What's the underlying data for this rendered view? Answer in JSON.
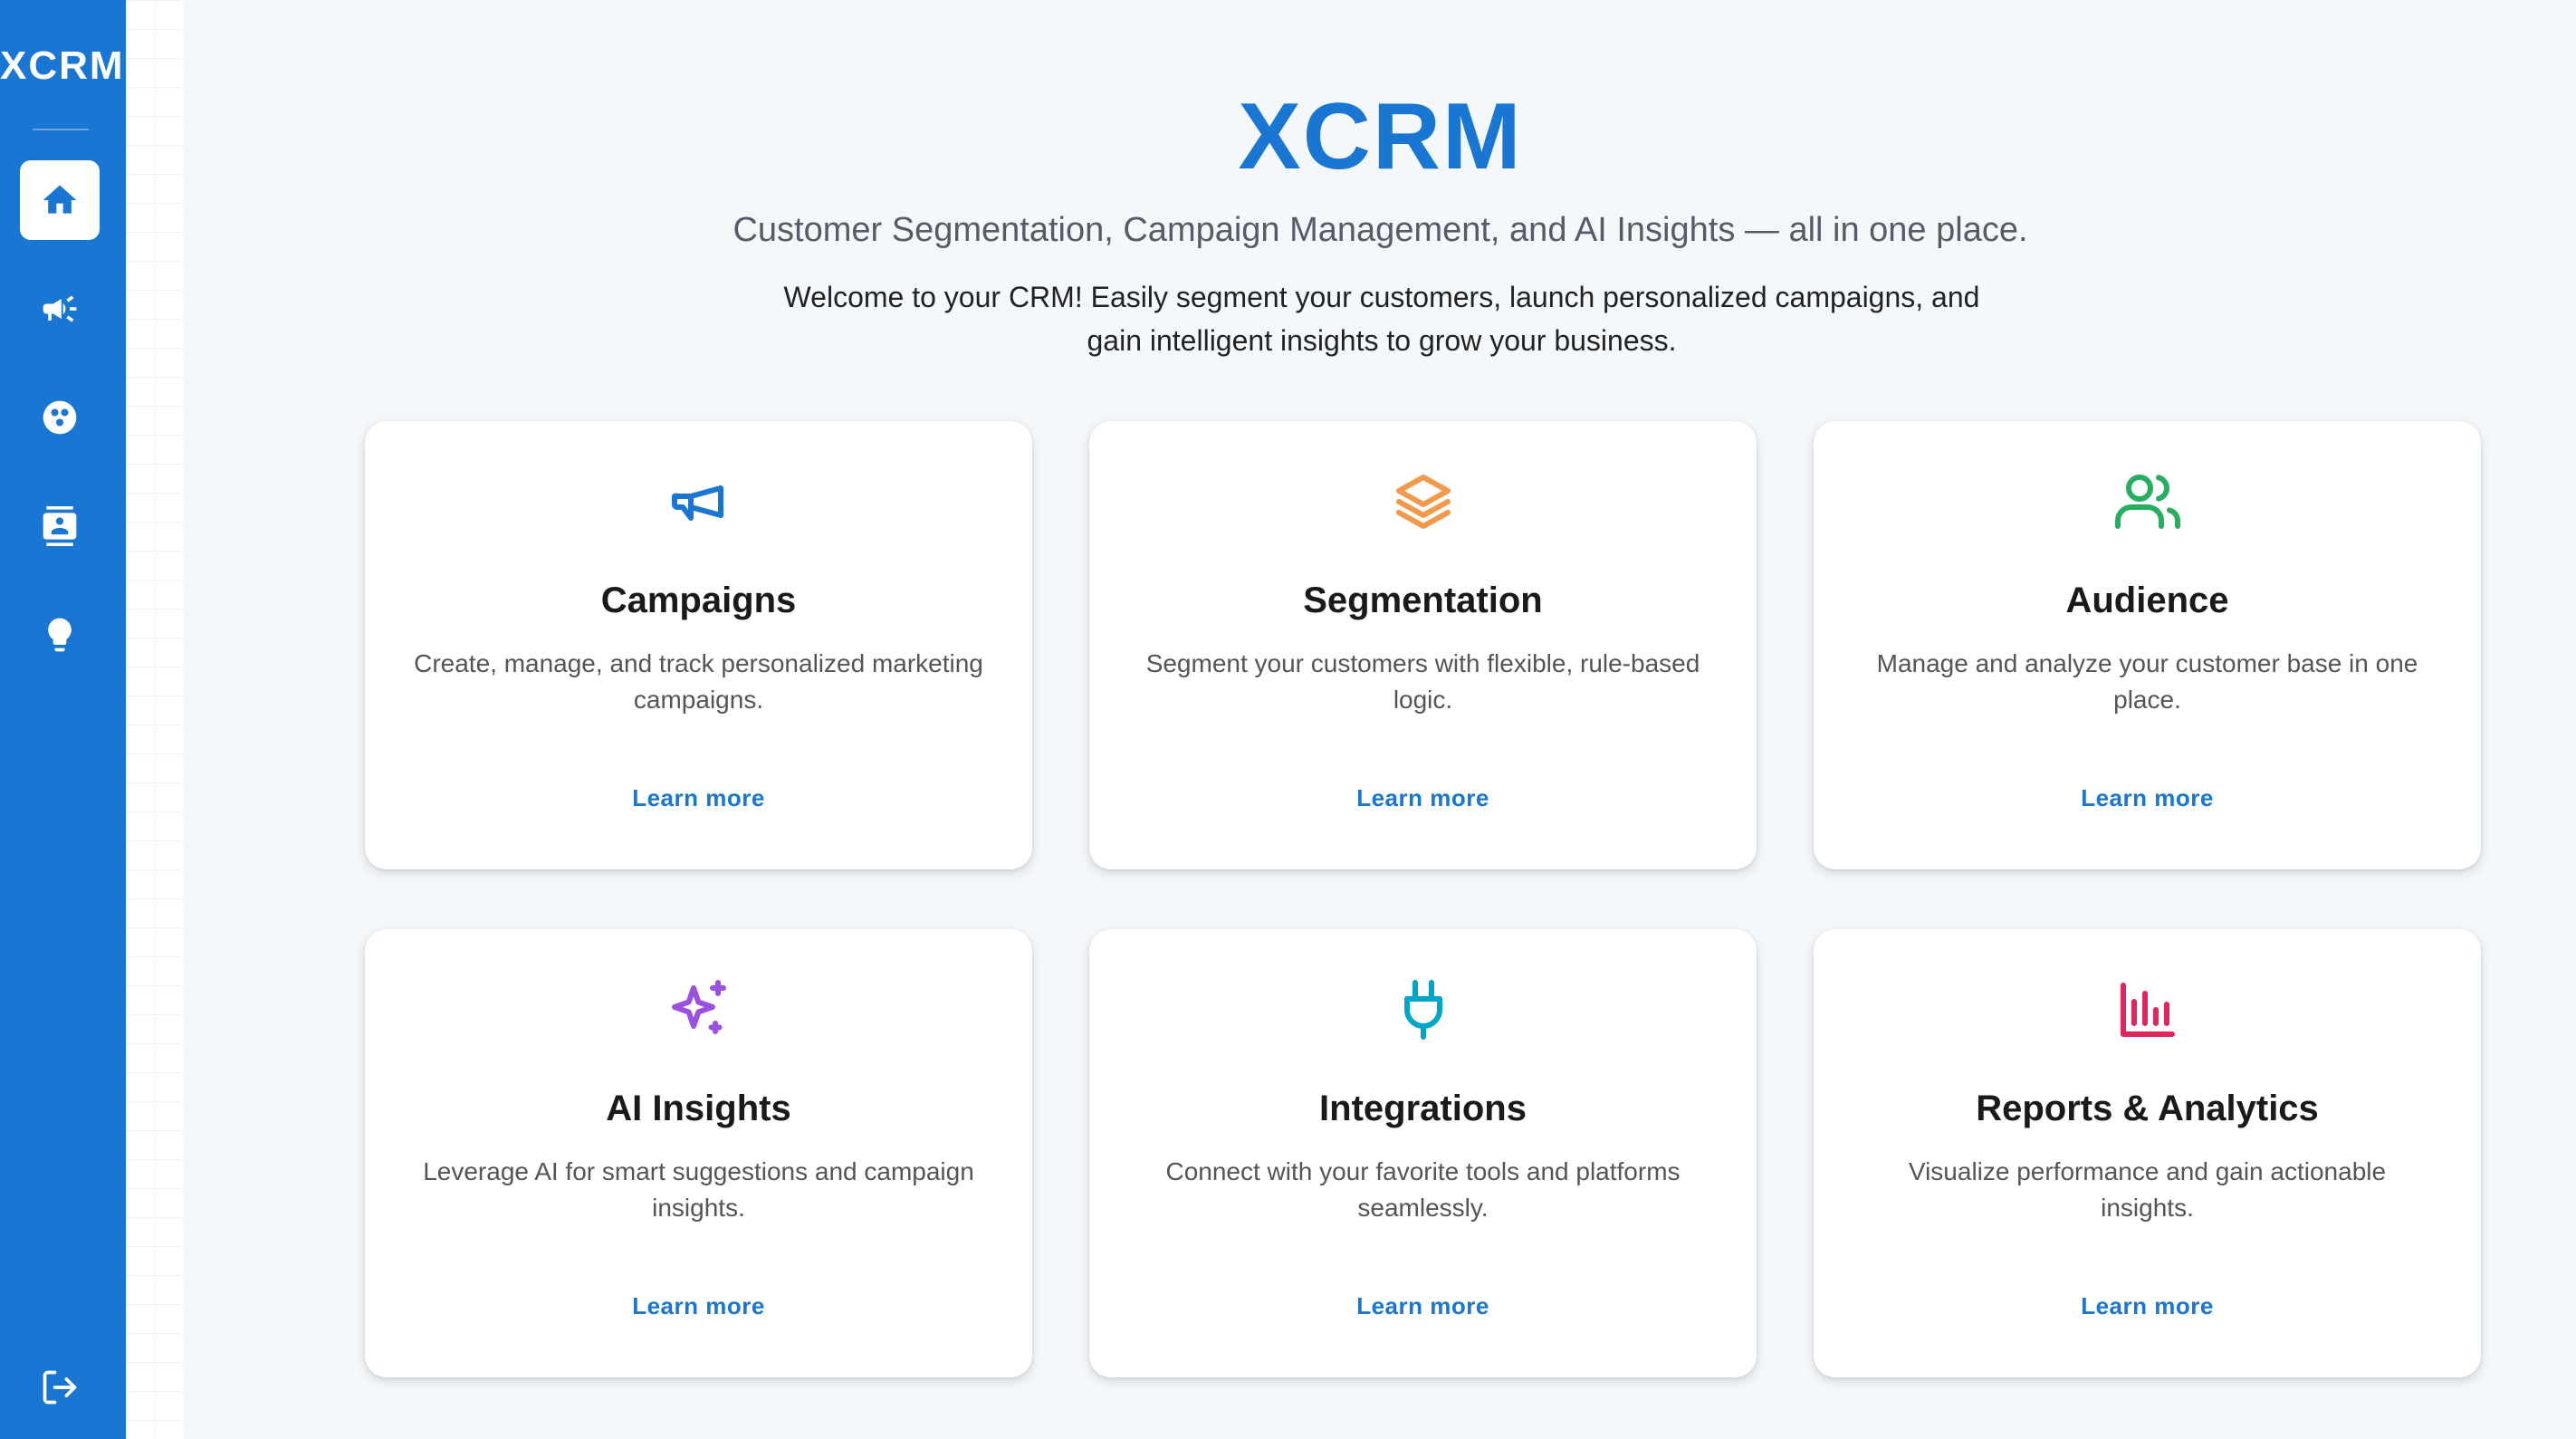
{
  "sidebar": {
    "brand": "XCRM",
    "items": [
      {
        "name": "home",
        "icon": "home-icon",
        "active": true
      },
      {
        "name": "campaigns",
        "icon": "megaphone-icon",
        "active": false
      },
      {
        "name": "segmentation",
        "icon": "segments-icon",
        "active": false
      },
      {
        "name": "audience",
        "icon": "contact-card-icon",
        "active": false
      },
      {
        "name": "insights",
        "icon": "lightbulb-icon",
        "active": false
      }
    ],
    "logout_icon": "logout-icon"
  },
  "hero": {
    "title": "XCRM",
    "subtitle": "Customer Segmentation, Campaign Management, and AI Insights — all in one place.",
    "welcome": "Welcome to your CRM! Easily segment your customers, launch personalized campaigns, and gain intelligent insights to grow your business."
  },
  "cards": [
    {
      "title": "Campaigns",
      "description": "Create, manage, and track personalized marketing campaigns.",
      "link": "Learn more",
      "icon": "megaphone-icon",
      "color": "#1976d2"
    },
    {
      "title": "Segmentation",
      "description": "Segment your customers with flexible, rule-based logic.",
      "link": "Learn more",
      "icon": "layers-icon",
      "color": "#f2994a"
    },
    {
      "title": "Audience",
      "description": "Manage and analyze your customer base in one place.",
      "link": "Learn more",
      "icon": "users-icon",
      "color": "#27ae60"
    },
    {
      "title": "AI Insights",
      "description": "Leverage AI for smart suggestions and campaign insights.",
      "link": "Learn more",
      "icon": "sparkles-icon",
      "color": "#9b51e0"
    },
    {
      "title": "Integrations",
      "description": "Connect with your favorite tools and platforms seamlessly.",
      "link": "Learn more",
      "icon": "plug-icon",
      "color": "#00a6c7"
    },
    {
      "title": "Reports & Analytics",
      "description": "Visualize performance and gain actionable insights.",
      "link": "Learn more",
      "icon": "bar-chart-icon",
      "color": "#e0245e"
    }
  ],
  "colors": {
    "primary": "#1976d2",
    "background": "#f5f8fb"
  }
}
